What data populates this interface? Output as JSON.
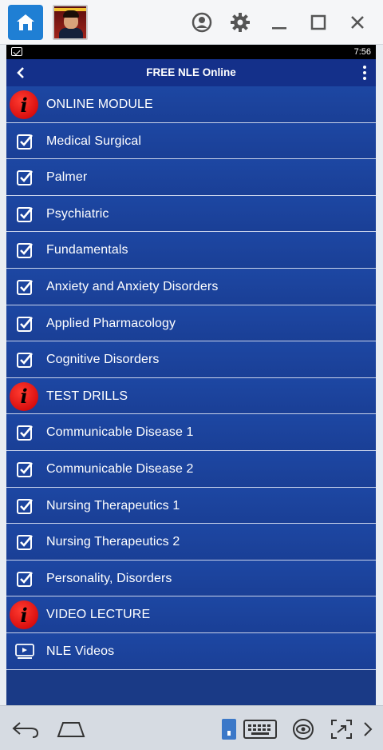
{
  "status_bar": {
    "time": "7:56"
  },
  "app_bar": {
    "title": "FREE NLE Online"
  },
  "sections": [
    {
      "header": "ONLINE MODULE",
      "items": [
        "Medical Surgical",
        "Palmer",
        "Psychiatric",
        "Fundamentals",
        "Anxiety and Anxiety Disorders",
        "Applied Pharmacology",
        "Cognitive Disorders"
      ]
    },
    {
      "header": "TEST DRILLS",
      "items": [
        "Communicable Disease 1",
        "Communicable Disease 2",
        "Nursing Therapeutics 1",
        "Nursing Therapeutics 2",
        "Personality, Disorders"
      ]
    },
    {
      "header": "VIDEO LECTURE",
      "items": [
        "NLE Videos"
      ]
    }
  ],
  "icons": {
    "section_header": "info-icon",
    "item_checked": "checkbox-checked-icon",
    "video_item": "video-play-icon"
  },
  "colors": {
    "list_background": "#1d47a3",
    "app_bar": "#14308a",
    "info_badge": "#e01b1b"
  }
}
